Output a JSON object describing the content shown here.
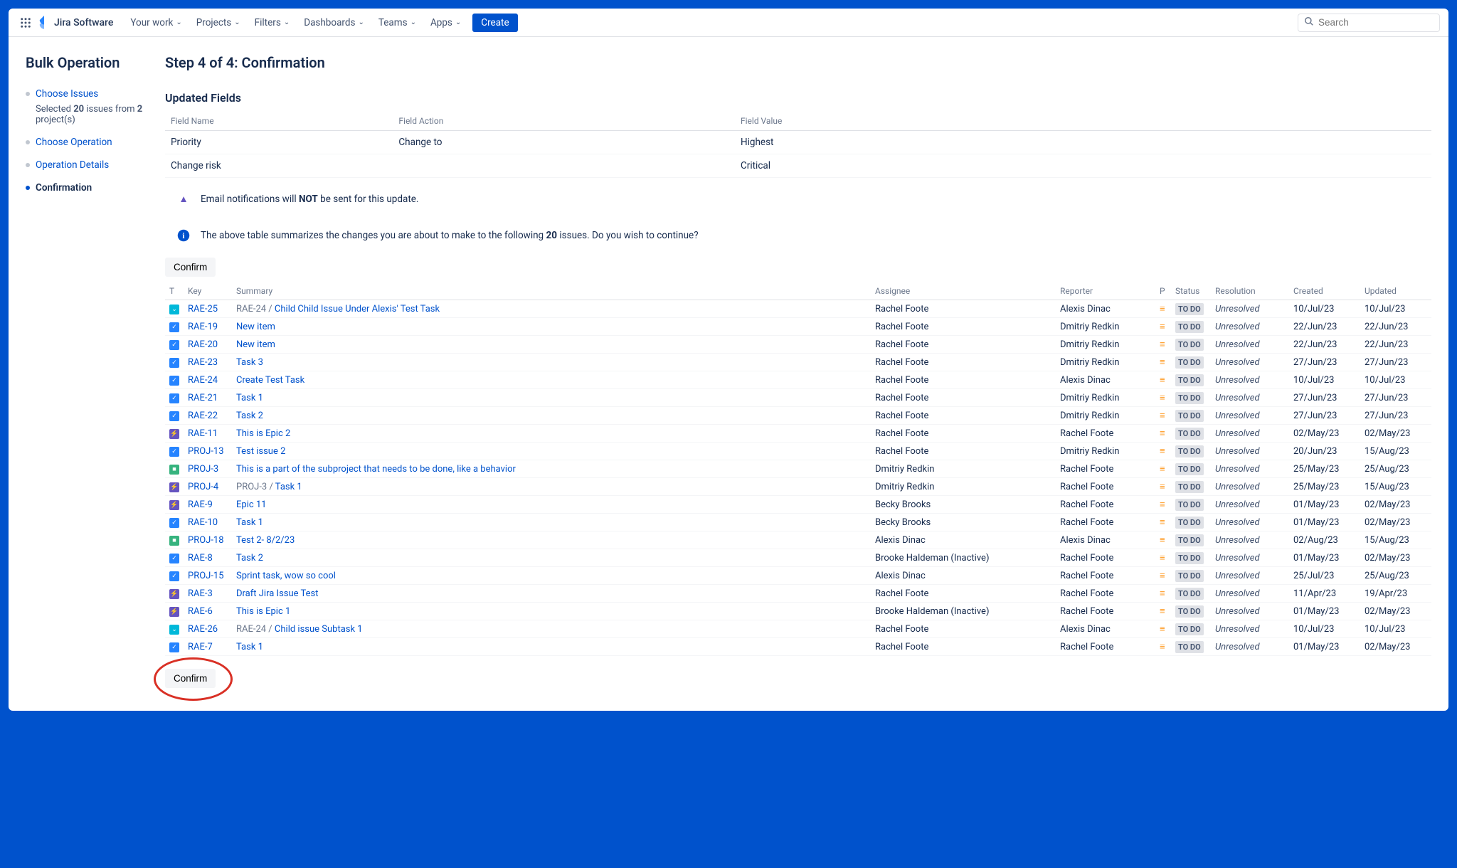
{
  "nav": {
    "product": "Jira Software",
    "items": [
      "Your work",
      "Projects",
      "Filters",
      "Dashboards",
      "Teams",
      "Apps"
    ],
    "create": "Create",
    "search_placeholder": "Search"
  },
  "sidebar": {
    "title": "Bulk Operation",
    "steps": [
      {
        "label": "Choose Issues",
        "sub_prefix": "Selected ",
        "sub_count": "20",
        "sub_mid": " issues from ",
        "sub_proj": "2",
        "sub_suffix": " project(s)",
        "link": true
      },
      {
        "label": "Choose Operation",
        "link": true
      },
      {
        "label": "Operation Details",
        "link": true
      },
      {
        "label": "Confirmation",
        "active": true
      }
    ]
  },
  "page": {
    "title": "Step 4 of 4: Confirmation",
    "updated_heading": "Updated Fields",
    "fields_headers": [
      "Field Name",
      "Field Action",
      "Field Value"
    ],
    "fields": [
      {
        "name": "Priority",
        "action": "Change to",
        "value": "Highest"
      },
      {
        "name": "Change risk",
        "action": "",
        "value": "Critical"
      }
    ],
    "warn_prefix": "Email notifications will ",
    "warn_bold": "NOT",
    "warn_suffix": " be sent for this update.",
    "info_prefix": "The above table summarizes the changes you are about to make to the following ",
    "info_count": "20",
    "info_suffix": " issues. Do you wish to continue?",
    "confirm_label": "Confirm"
  },
  "table": {
    "headers": {
      "t": "T",
      "key": "Key",
      "summary": "Summary",
      "assignee": "Assignee",
      "reporter": "Reporter",
      "p": "P",
      "status": "Status",
      "resolution": "Resolution",
      "created": "Created",
      "updated": "Updated"
    },
    "rows": [
      {
        "type": "sub",
        "key": "RAE-25",
        "prefix": "RAE-24 / ",
        "summary": "Child Child Issue Under Alexis' Test Task",
        "assignee": "Rachel Foote",
        "reporter": "Alexis Dinac",
        "status": "TO DO",
        "resolution": "Unresolved",
        "created": "10/Jul/23",
        "updated": "10/Jul/23"
      },
      {
        "type": "task",
        "key": "RAE-19",
        "summary": "New item",
        "assignee": "Rachel Foote",
        "reporter": "Dmitriy Redkin",
        "status": "TO DO",
        "resolution": "Unresolved",
        "created": "22/Jun/23",
        "updated": "22/Jun/23"
      },
      {
        "type": "task",
        "key": "RAE-20",
        "summary": "New item",
        "assignee": "Rachel Foote",
        "reporter": "Dmitriy Redkin",
        "status": "TO DO",
        "resolution": "Unresolved",
        "created": "22/Jun/23",
        "updated": "22/Jun/23"
      },
      {
        "type": "task",
        "key": "RAE-23",
        "summary": "Task 3",
        "assignee": "Rachel Foote",
        "reporter": "Dmitriy Redkin",
        "status": "TO DO",
        "resolution": "Unresolved",
        "created": "27/Jun/23",
        "updated": "27/Jun/23"
      },
      {
        "type": "task",
        "key": "RAE-24",
        "summary": "Create Test Task",
        "assignee": "Rachel Foote",
        "reporter": "Alexis Dinac",
        "status": "TO DO",
        "resolution": "Unresolved",
        "created": "10/Jul/23",
        "updated": "10/Jul/23"
      },
      {
        "type": "task",
        "key": "RAE-21",
        "summary": "Task 1",
        "assignee": "Rachel Foote",
        "reporter": "Dmitriy Redkin",
        "status": "TO DO",
        "resolution": "Unresolved",
        "created": "27/Jun/23",
        "updated": "27/Jun/23"
      },
      {
        "type": "task",
        "key": "RAE-22",
        "summary": "Task 2",
        "assignee": "Rachel Foote",
        "reporter": "Dmitriy Redkin",
        "status": "TO DO",
        "resolution": "Unresolved",
        "created": "27/Jun/23",
        "updated": "27/Jun/23"
      },
      {
        "type": "epic",
        "key": "RAE-11",
        "summary": "This is Epic 2",
        "assignee": "Rachel Foote",
        "reporter": "Rachel Foote",
        "status": "TO DO",
        "resolution": "Unresolved",
        "created": "02/May/23",
        "updated": "02/May/23"
      },
      {
        "type": "task",
        "key": "PROJ-13",
        "summary": "Test issue 2",
        "assignee": "Rachel Foote",
        "reporter": "Dmitriy Redkin",
        "status": "TO DO",
        "resolution": "Unresolved",
        "created": "20/Jun/23",
        "updated": "15/Aug/23"
      },
      {
        "type": "story",
        "key": "PROJ-3",
        "summary": "This is a part of the subproject that needs to be done, like a behavior",
        "assignee": "Dmitriy Redkin",
        "reporter": "Rachel Foote",
        "status": "TO DO",
        "resolution": "Unresolved",
        "created": "25/May/23",
        "updated": "25/Aug/23"
      },
      {
        "type": "epic",
        "key": "PROJ-4",
        "prefix": "PROJ-3 / ",
        "summary": "Task 1",
        "assignee": "Dmitriy Redkin",
        "reporter": "Rachel Foote",
        "status": "TO DO",
        "resolution": "Unresolved",
        "created": "25/May/23",
        "updated": "15/Aug/23"
      },
      {
        "type": "epic",
        "key": "RAE-9",
        "summary": "Epic 11",
        "assignee": "Becky Brooks",
        "reporter": "Rachel Foote",
        "status": "TO DO",
        "resolution": "Unresolved",
        "created": "01/May/23",
        "updated": "02/May/23"
      },
      {
        "type": "task",
        "key": "RAE-10",
        "summary": "Task 1",
        "assignee": "Becky Brooks",
        "reporter": "Rachel Foote",
        "status": "TO DO",
        "resolution": "Unresolved",
        "created": "01/May/23",
        "updated": "02/May/23"
      },
      {
        "type": "story",
        "key": "PROJ-18",
        "summary": "Test 2- 8/2/23",
        "assignee": "Alexis Dinac",
        "reporter": "Alexis Dinac",
        "status": "TO DO",
        "resolution": "Unresolved",
        "created": "02/Aug/23",
        "updated": "15/Aug/23"
      },
      {
        "type": "task",
        "key": "RAE-8",
        "summary": "Task 2",
        "assignee": "Brooke Haldeman (Inactive)",
        "reporter": "Rachel Foote",
        "status": "TO DO",
        "resolution": "Unresolved",
        "created": "01/May/23",
        "updated": "02/May/23"
      },
      {
        "type": "task",
        "key": "PROJ-15",
        "summary": "Sprint task, wow so cool",
        "assignee": "Alexis Dinac",
        "reporter": "Rachel Foote",
        "status": "TO DO",
        "resolution": "Unresolved",
        "created": "25/Jul/23",
        "updated": "25/Aug/23"
      },
      {
        "type": "epic",
        "key": "RAE-3",
        "summary": "Draft Jira Issue Test",
        "assignee": "Rachel Foote",
        "reporter": "Rachel Foote",
        "status": "TO DO",
        "resolution": "Unresolved",
        "created": "11/Apr/23",
        "updated": "19/Apr/23"
      },
      {
        "type": "epic",
        "key": "RAE-6",
        "summary": "This is Epic 1",
        "assignee": "Brooke Haldeman (Inactive)",
        "reporter": "Rachel Foote",
        "status": "TO DO",
        "resolution": "Unresolved",
        "created": "01/May/23",
        "updated": "02/May/23"
      },
      {
        "type": "sub",
        "key": "RAE-26",
        "prefix": "RAE-24 / ",
        "summary": "Child issue Subtask 1",
        "assignee": "Rachel Foote",
        "reporter": "Alexis Dinac",
        "status": "TO DO",
        "resolution": "Unresolved",
        "created": "10/Jul/23",
        "updated": "10/Jul/23"
      },
      {
        "type": "task",
        "key": "RAE-7",
        "summary": "Task 1",
        "assignee": "Rachel Foote",
        "reporter": "Rachel Foote",
        "status": "TO DO",
        "resolution": "Unresolved",
        "created": "01/May/23",
        "updated": "02/May/23"
      }
    ]
  }
}
